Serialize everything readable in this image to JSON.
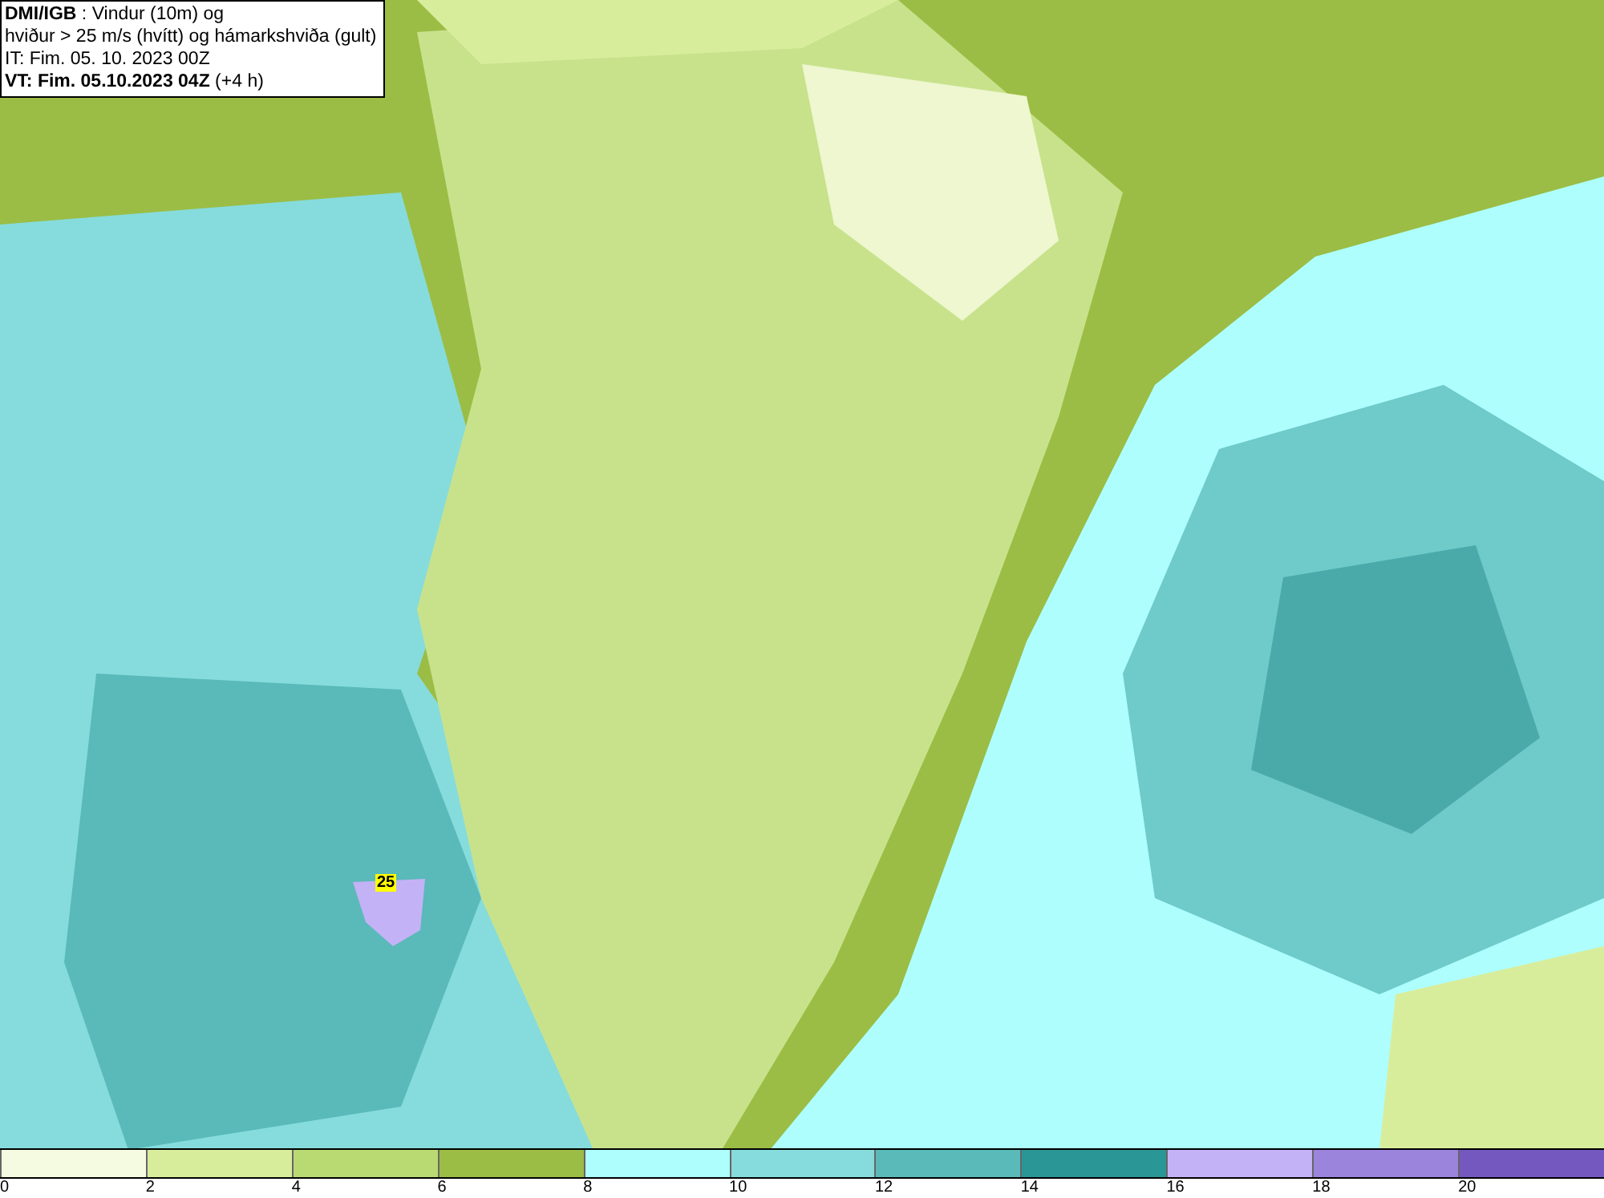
{
  "info_box": {
    "lines": [
      "**DMI/IGB** : Vindur (10m) og",
      "hviður > 25 m/s (hvítt) og hámarkshviða (gult)",
      "IT: Fim. 05. 10. 2023 00Z",
      "**VT: Fim. 05.10.2023 04Z** (+4 h)"
    ]
  },
  "map": {
    "gust_label": "25"
  },
  "legend": {
    "bins": [
      {
        "color": "#f5fbe0"
      },
      {
        "color": "#d8ed9c"
      },
      {
        "color": "#b9da72"
      },
      {
        "color": "#9bbd45"
      },
      {
        "color": "#aefefe"
      },
      {
        "color": "#86dcdc"
      },
      {
        "color": "#5ab9b9"
      },
      {
        "color": "#2a9696"
      },
      {
        "color": "#c4b2f6"
      },
      {
        "color": "#9b84dc"
      },
      {
        "color": "#7458c0"
      }
    ],
    "ticks": [
      "0",
      "2",
      "4",
      "6",
      "8",
      "10",
      "12",
      "14",
      "16",
      "18",
      "20"
    ]
  }
}
